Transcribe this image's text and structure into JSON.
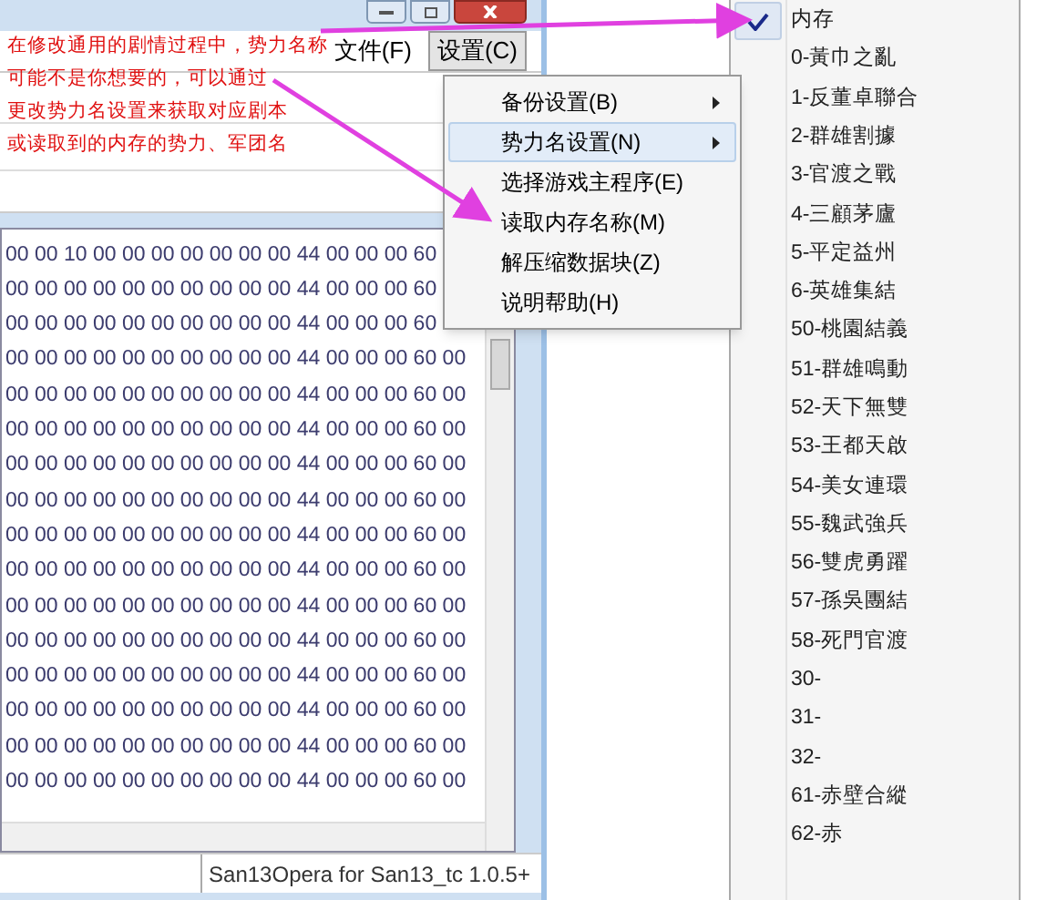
{
  "window": {
    "menu_bar": [
      {
        "label": "文件(F)",
        "selected": false
      },
      {
        "label": "设置(C)",
        "selected": true
      }
    ],
    "hex_rows": [
      "00 00 10 00 00 00 00 00 00 00 44 00 00 00 60",
      "00 00 00 00 00 00 00 00 00 00 44 00 00 00 60",
      "00 00 00 00 00 00 00 00 00 00 44 00 00 00 60",
      "00 00 00 00 00 00 00 00 00 00 44 00 00 00 60 00",
      "00 00 00 00 00 00 00 00 00 00 44 00 00 00 60 00",
      "00 00 00 00 00 00 00 00 00 00 44 00 00 00 60 00",
      "00 00 00 00 00 00 00 00 00 00 44 00 00 00 60 00",
      "00 00 00 00 00 00 00 00 00 00 44 00 00 00 60 00",
      "00 00 00 00 00 00 00 00 00 00 44 00 00 00 60 00",
      "00 00 00 00 00 00 00 00 00 00 44 00 00 00 60 00",
      "00 00 00 00 00 00 00 00 00 00 44 00 00 00 60 00",
      "00 00 00 00 00 00 00 00 00 00 44 00 00 00 60 00",
      "00 00 00 00 00 00 00 00 00 00 44 00 00 00 60 00",
      "00 00 00 00 00 00 00 00 00 00 44 00 00 00 60 00",
      "00 00 00 00 00 00 00 00 00 00 44 00 00 00 60 00",
      "00 00 00 00 00 00 00 00 00 00 44 00 00 00 60 00"
    ],
    "status_bar": "San13Opera for San13_tc 1.0.5+"
  },
  "settings_menu": [
    {
      "label": "备份设置(B)",
      "submenu": true,
      "selected": false
    },
    {
      "label": "势力名设置(N)",
      "submenu": true,
      "selected": true
    },
    {
      "label": "选择游戏主程序(E)",
      "submenu": false,
      "selected": false
    },
    {
      "label": "读取内存名称(M)",
      "submenu": false,
      "selected": false
    },
    {
      "label": "解压缩数据块(Z)",
      "submenu": false,
      "selected": false
    },
    {
      "label": "说明帮助(H)",
      "submenu": false,
      "selected": false
    }
  ],
  "faction_submenu": [
    {
      "label": "内存",
      "checked": true
    },
    {
      "label": "0-黃巾之亂",
      "checked": false
    },
    {
      "label": "1-反董卓聯合",
      "checked": false
    },
    {
      "label": "2-群雄割據",
      "checked": false
    },
    {
      "label": "3-官渡之戰",
      "checked": false
    },
    {
      "label": "4-三顧茅廬",
      "checked": false
    },
    {
      "label": "5-平定益州",
      "checked": false
    },
    {
      "label": "6-英雄集結",
      "checked": false
    },
    {
      "label": "50-桃園結義",
      "checked": false
    },
    {
      "label": "51-群雄鳴動",
      "checked": false
    },
    {
      "label": "52-天下無雙",
      "checked": false
    },
    {
      "label": "53-王都天啟",
      "checked": false
    },
    {
      "label": "54-美女連環",
      "checked": false
    },
    {
      "label": "55-魏武強兵",
      "checked": false
    },
    {
      "label": "56-雙虎勇躍",
      "checked": false
    },
    {
      "label": "57-孫吳團結",
      "checked": false
    },
    {
      "label": "58-死門官渡",
      "checked": false
    },
    {
      "label": "30-",
      "checked": false
    },
    {
      "label": "31-",
      "checked": false
    },
    {
      "label": "32-",
      "checked": false
    },
    {
      "label": "61-赤壁合縱",
      "checked": false
    },
    {
      "label": "62-赤",
      "checked": false
    }
  ],
  "annotation": [
    "在修改通用的剧情过程中，势力名称",
    "可能不是你想要的，可以通过",
    "更改势力名设置来获取对应剧本",
    "或读取到的内存的势力、军团名"
  ]
}
